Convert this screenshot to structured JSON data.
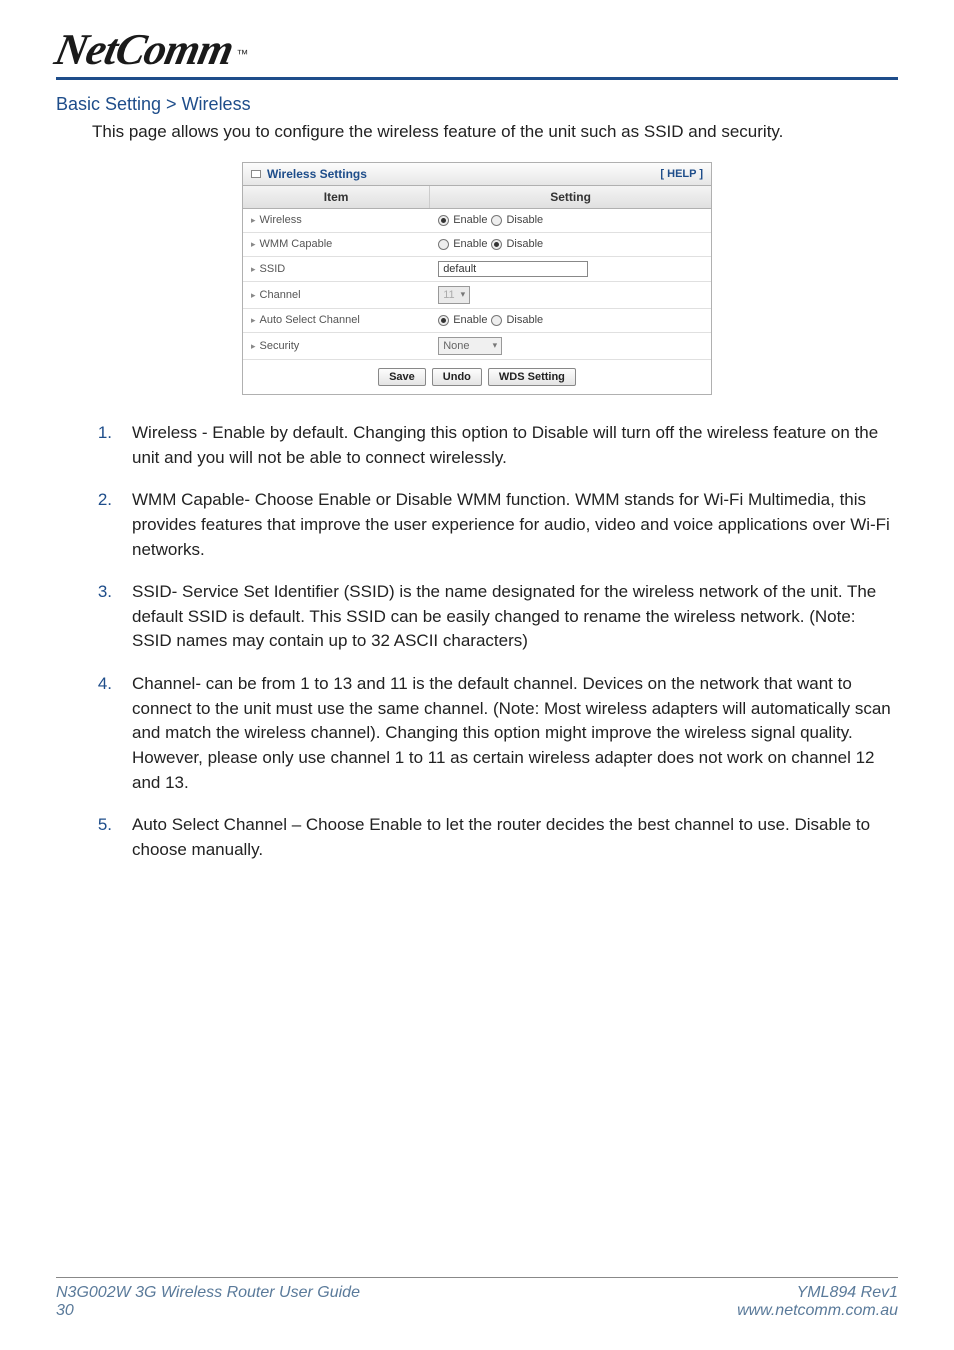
{
  "logo": {
    "text": "NetComm",
    "tm": "™"
  },
  "breadcrumb": "Basic Setting > Wireless",
  "intro": "This page allows you to configure the wireless feature of the unit such as SSID and security.",
  "panel": {
    "title": "Wireless Settings",
    "help": "[ HELP ]",
    "col_item": "Item",
    "col_setting": "Setting",
    "rows": {
      "wireless": {
        "label": "Wireless",
        "enable": "Enable",
        "disable": "Disable"
      },
      "wmm": {
        "label": "WMM Capable",
        "enable": "Enable",
        "disable": "Disable"
      },
      "ssid": {
        "label": "SSID",
        "value": "default"
      },
      "channel": {
        "label": "Channel",
        "value": "11"
      },
      "auto": {
        "label": "Auto Select Channel",
        "enable": "Enable",
        "disable": "Disable"
      },
      "security": {
        "label": "Security",
        "value": "None"
      }
    },
    "buttons": {
      "save": "Save",
      "undo": "Undo",
      "wds": "WDS Setting"
    }
  },
  "list": [
    "Wireless - Enable by default. Changing this option to Disable will turn off the wireless feature on the unit and you will not be able to connect wirelessly.",
    "WMM Capable- Choose Enable or Disable WMM function. WMM stands for Wi-Fi Multimedia, this provides features that improve the user experience for audio, video and voice applications over Wi-Fi networks.",
    "SSID- Service Set Identifier (SSID) is the name designated for the wireless network of the unit. The default SSID is default. This SSID can be easily changed to rename the wireless network. (Note: SSID names may contain up to 32 ASCII characters)",
    "Channel- can be from 1 to 13 and 11 is the default channel. Devices on the network that want to connect to the unit must use the same channel. (Note: Most wireless adapters will automatically scan and match the wireless channel). Changing this option might improve the wireless signal quality. However, please only use channel 1 to 11 as certain wireless adapter does not work on channel 12 and 13.",
    "Auto Select Channel – Choose Enable to let the router decides the best channel to use. Disable to choose manually."
  ],
  "footer": {
    "left_top": "N3G002W 3G Wireless Router User Guide",
    "left_bottom": "30",
    "right_top": "YML894 Rev1",
    "right_bottom": "www.netcomm.com.au"
  }
}
